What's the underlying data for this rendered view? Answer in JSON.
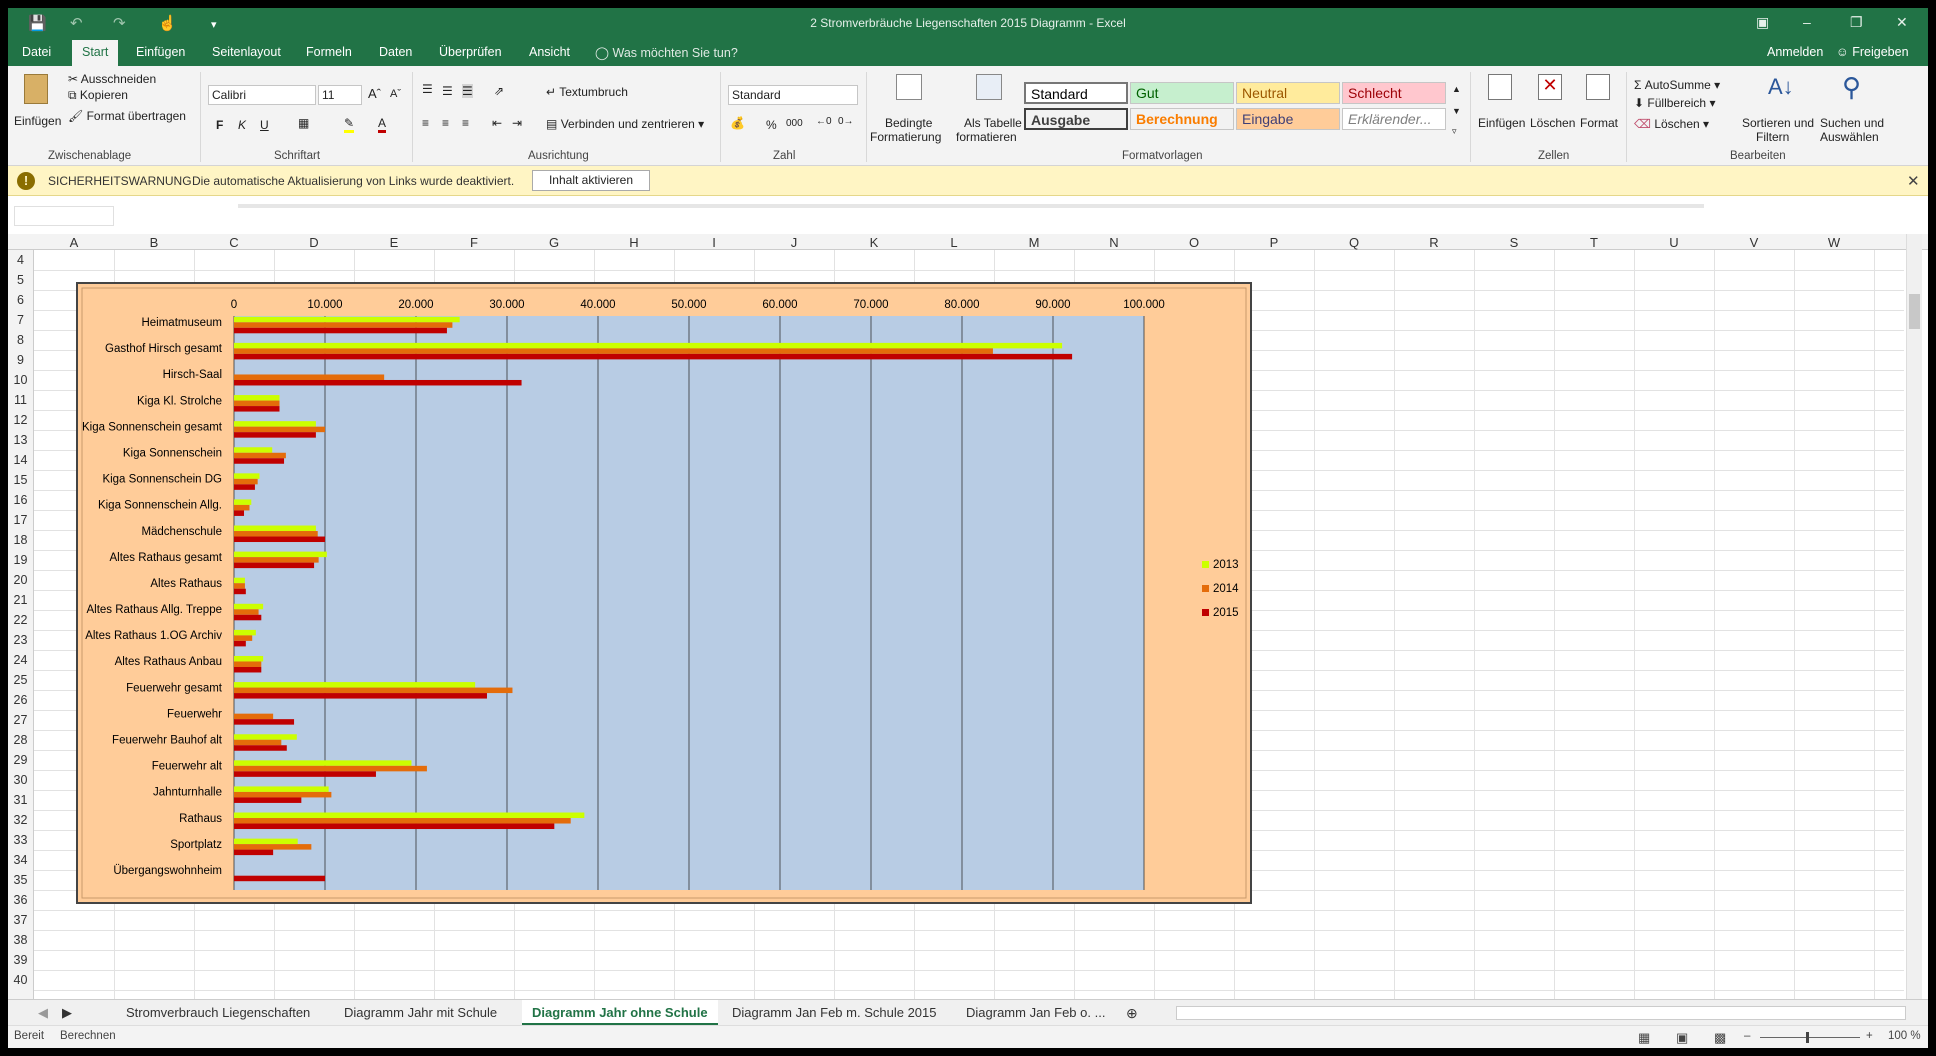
{
  "window": {
    "title": "2 Stromverbräuche Liegenschaften 2015 Diagramm - Excel"
  },
  "ribbon_tabs": [
    "Datei",
    "Start",
    "Einfügen",
    "Seitenlayout",
    "Formeln",
    "Daten",
    "Überprüfen",
    "Ansicht"
  ],
  "active_tab": "Start",
  "tell_me": "Was möchten Sie tun?",
  "account": {
    "signin": "Anmelden",
    "share": "Freigeben"
  },
  "clipboard": {
    "paste": "Einfügen",
    "cut": "Ausschneiden",
    "copy": "Kopieren",
    "format_painter": "Format übertragen",
    "group": "Zwischenablage"
  },
  "font": {
    "name": "Calibri",
    "size": "11",
    "bold": "F",
    "italic": "K",
    "underline": "U",
    "group": "Schriftart"
  },
  "alignment": {
    "wrap": "Textumbruch",
    "merge": "Verbinden und zentrieren",
    "group": "Ausrichtung"
  },
  "number": {
    "format": "Standard",
    "percent": "%",
    "thousands": "000",
    "group": "Zahl"
  },
  "styles": {
    "cond_format": [
      "Bedingte",
      "Formatierung"
    ],
    "as_table": [
      "Als Tabelle",
      "formatieren"
    ],
    "cells": [
      {
        "label": "Standard",
        "bg": "#ffffff",
        "fg": "#000000"
      },
      {
        "label": "Gut",
        "bg": "#c6efce",
        "fg": "#006100"
      },
      {
        "label": "Neutral",
        "bg": "#ffeb9c",
        "fg": "#9c5700"
      },
      {
        "label": "Schlecht",
        "bg": "#ffc7ce",
        "fg": "#9c0006"
      },
      {
        "label": "Ausgabe",
        "bg": "#f2f2f2",
        "fg": "#3f3f3f"
      },
      {
        "label": "Berechnung",
        "bg": "#f2f2f2",
        "fg": "#fa7d00"
      },
      {
        "label": "Eingabe",
        "bg": "#ffcc99",
        "fg": "#3f3f76"
      },
      {
        "label": "Erklärender...",
        "bg": "#ffffff",
        "fg": "#7f7f7f"
      }
    ],
    "group": "Formatvorlagen"
  },
  "cells_group": {
    "insert": "Einfügen",
    "delete": "Löschen",
    "format": "Format",
    "group": "Zellen"
  },
  "editing": {
    "autosum": "AutoSumme",
    "fill": "Füllbereich",
    "clear": "Löschen",
    "sort": [
      "Sortieren und",
      "Filtern"
    ],
    "find": [
      "Suchen und",
      "Auswählen"
    ],
    "group": "Bearbeiten"
  },
  "security": {
    "title": "SICHERHEITSWARNUNG",
    "message": "Die automatische Aktualisierung von Links wurde deaktiviert.",
    "button": "Inhalt aktivieren"
  },
  "columns": [
    "A",
    "B",
    "C",
    "D",
    "E",
    "F",
    "G",
    "H",
    "I",
    "J",
    "K",
    "L",
    "M",
    "N",
    "O",
    "P",
    "Q",
    "R",
    "S",
    "T",
    "U",
    "V",
    "W"
  ],
  "rows": [
    "4",
    "5",
    "6",
    "7",
    "8",
    "9",
    "10",
    "11",
    "12",
    "13",
    "14",
    "15",
    "16",
    "17",
    "18",
    "19",
    "20",
    "21",
    "22",
    "23",
    "24",
    "25",
    "26",
    "27",
    "28",
    "29",
    "30",
    "31",
    "32",
    "33",
    "34",
    "35",
    "36",
    "37",
    "38",
    "39",
    "40"
  ],
  "sheet_tabs": [
    "Stromverbrauch Liegenschaften",
    "Diagramm Jahr mit Schule",
    "Diagramm Jahr ohne Schule",
    "Diagramm Jan Feb m. Schule 2015",
    "Diagramm Jan Feb o. ..."
  ],
  "active_sheet": "Diagramm Jahr ohne Schule",
  "status": {
    "ready": "Bereit",
    "calc": "Berechnen",
    "zoom": "100 %"
  },
  "chart_data": {
    "type": "bar",
    "orientation": "horizontal",
    "categories": [
      "Heimatmuseum",
      "Gasthof Hirsch gesamt",
      "Hirsch-Saal",
      "Kiga Kl. Strolche",
      "Kiga Sonnenschein gesamt",
      "Kiga Sonnenschein",
      "Kiga Sonnenschein DG",
      "Kiga Sonnenschein Allg.",
      "Mädchenschule",
      "Altes Rathaus gesamt",
      "Altes Rathaus",
      "Altes Rathaus Allg. Treppe",
      "Altes Rathaus 1.OG Archiv",
      "Altes Rathaus Anbau",
      "Feuerwehr gesamt",
      "Feuerwehr",
      "Feuerwehr Bauhof alt",
      "Feuerwehr alt",
      "Jahnturnhalle",
      "Rathaus",
      "Sportplatz",
      "Übergangswohnheim"
    ],
    "series": [
      {
        "name": "2013",
        "color": "#ccff00",
        "values": [
          24800,
          91000,
          0,
          5000,
          9000,
          4200,
          2800,
          1900,
          9000,
          10200,
          1200,
          3200,
          2400,
          3200,
          26500,
          0,
          6900,
          19500,
          10400,
          38500,
          7000,
          0
        ]
      },
      {
        "name": "2014",
        "color": "#e46c0a",
        "values": [
          24000,
          83400,
          16500,
          5000,
          10000,
          5700,
          2600,
          1700,
          9200,
          9300,
          1200,
          2700,
          2000,
          3000,
          30600,
          4300,
          5200,
          21200,
          10700,
          37000,
          8500,
          0
        ]
      },
      {
        "name": "2015",
        "color": "#c00000",
        "values": [
          23400,
          92100,
          31600,
          5000,
          9000,
          5500,
          2300,
          1100,
          10000,
          8800,
          1300,
          3000,
          1300,
          3000,
          27800,
          6600,
          5800,
          15600,
          7400,
          35200,
          4300,
          10000
        ]
      }
    ],
    "xlim": [
      0,
      100000
    ],
    "ticks": [
      "0",
      "10.000",
      "20.000",
      "30.000",
      "40.000",
      "50.000",
      "60.000",
      "70.000",
      "80.000",
      "90.000",
      "100.000"
    ],
    "grid": true,
    "legend": "right",
    "plot_bg": "#b8cce4",
    "chart_bg": "#ffcc99"
  }
}
